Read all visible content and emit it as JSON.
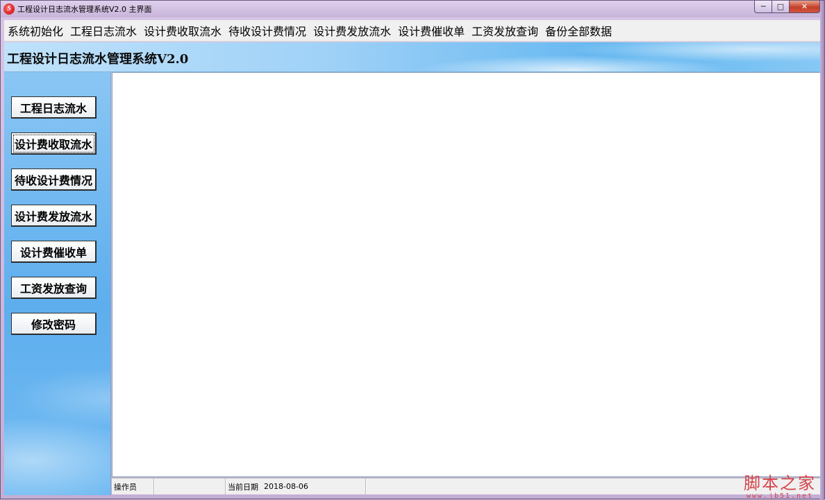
{
  "window": {
    "title": "工程设计日志流水管理系统V2.0 主界面",
    "logo_text": "S",
    "controls": {
      "minimize": "─",
      "maximize": "□",
      "close": "✕"
    }
  },
  "menubar": {
    "items": [
      "系统初始化",
      "工程日志流水",
      "设计费收取流水",
      "待收设计费情况",
      "设计费发放流水",
      "设计费催收单",
      "工资发放查询",
      "备份全部数据"
    ]
  },
  "banner": {
    "title": "工程设计日志流水管理系统V2.0"
  },
  "sidebar": {
    "buttons": [
      "工程日志流水",
      "设计费收取流水",
      "待收设计费情况",
      "设计费发放流水",
      "设计费催收单",
      "工资发放查询",
      "修改密码"
    ]
  },
  "statusbar": {
    "operator_label": "操作员",
    "operator_value": "",
    "date_label": "当前日期",
    "date_value": "2018-08-06"
  },
  "watermark": {
    "main": "脚本之家",
    "sub": "www.jb51.net"
  },
  "colors": {
    "banner_blue": "#62b6f0",
    "sidebar_blue": "#5eaeee",
    "window_frame": "#c8b4da",
    "close_red": "#c4402a",
    "watermark_red": "#d5434a"
  }
}
